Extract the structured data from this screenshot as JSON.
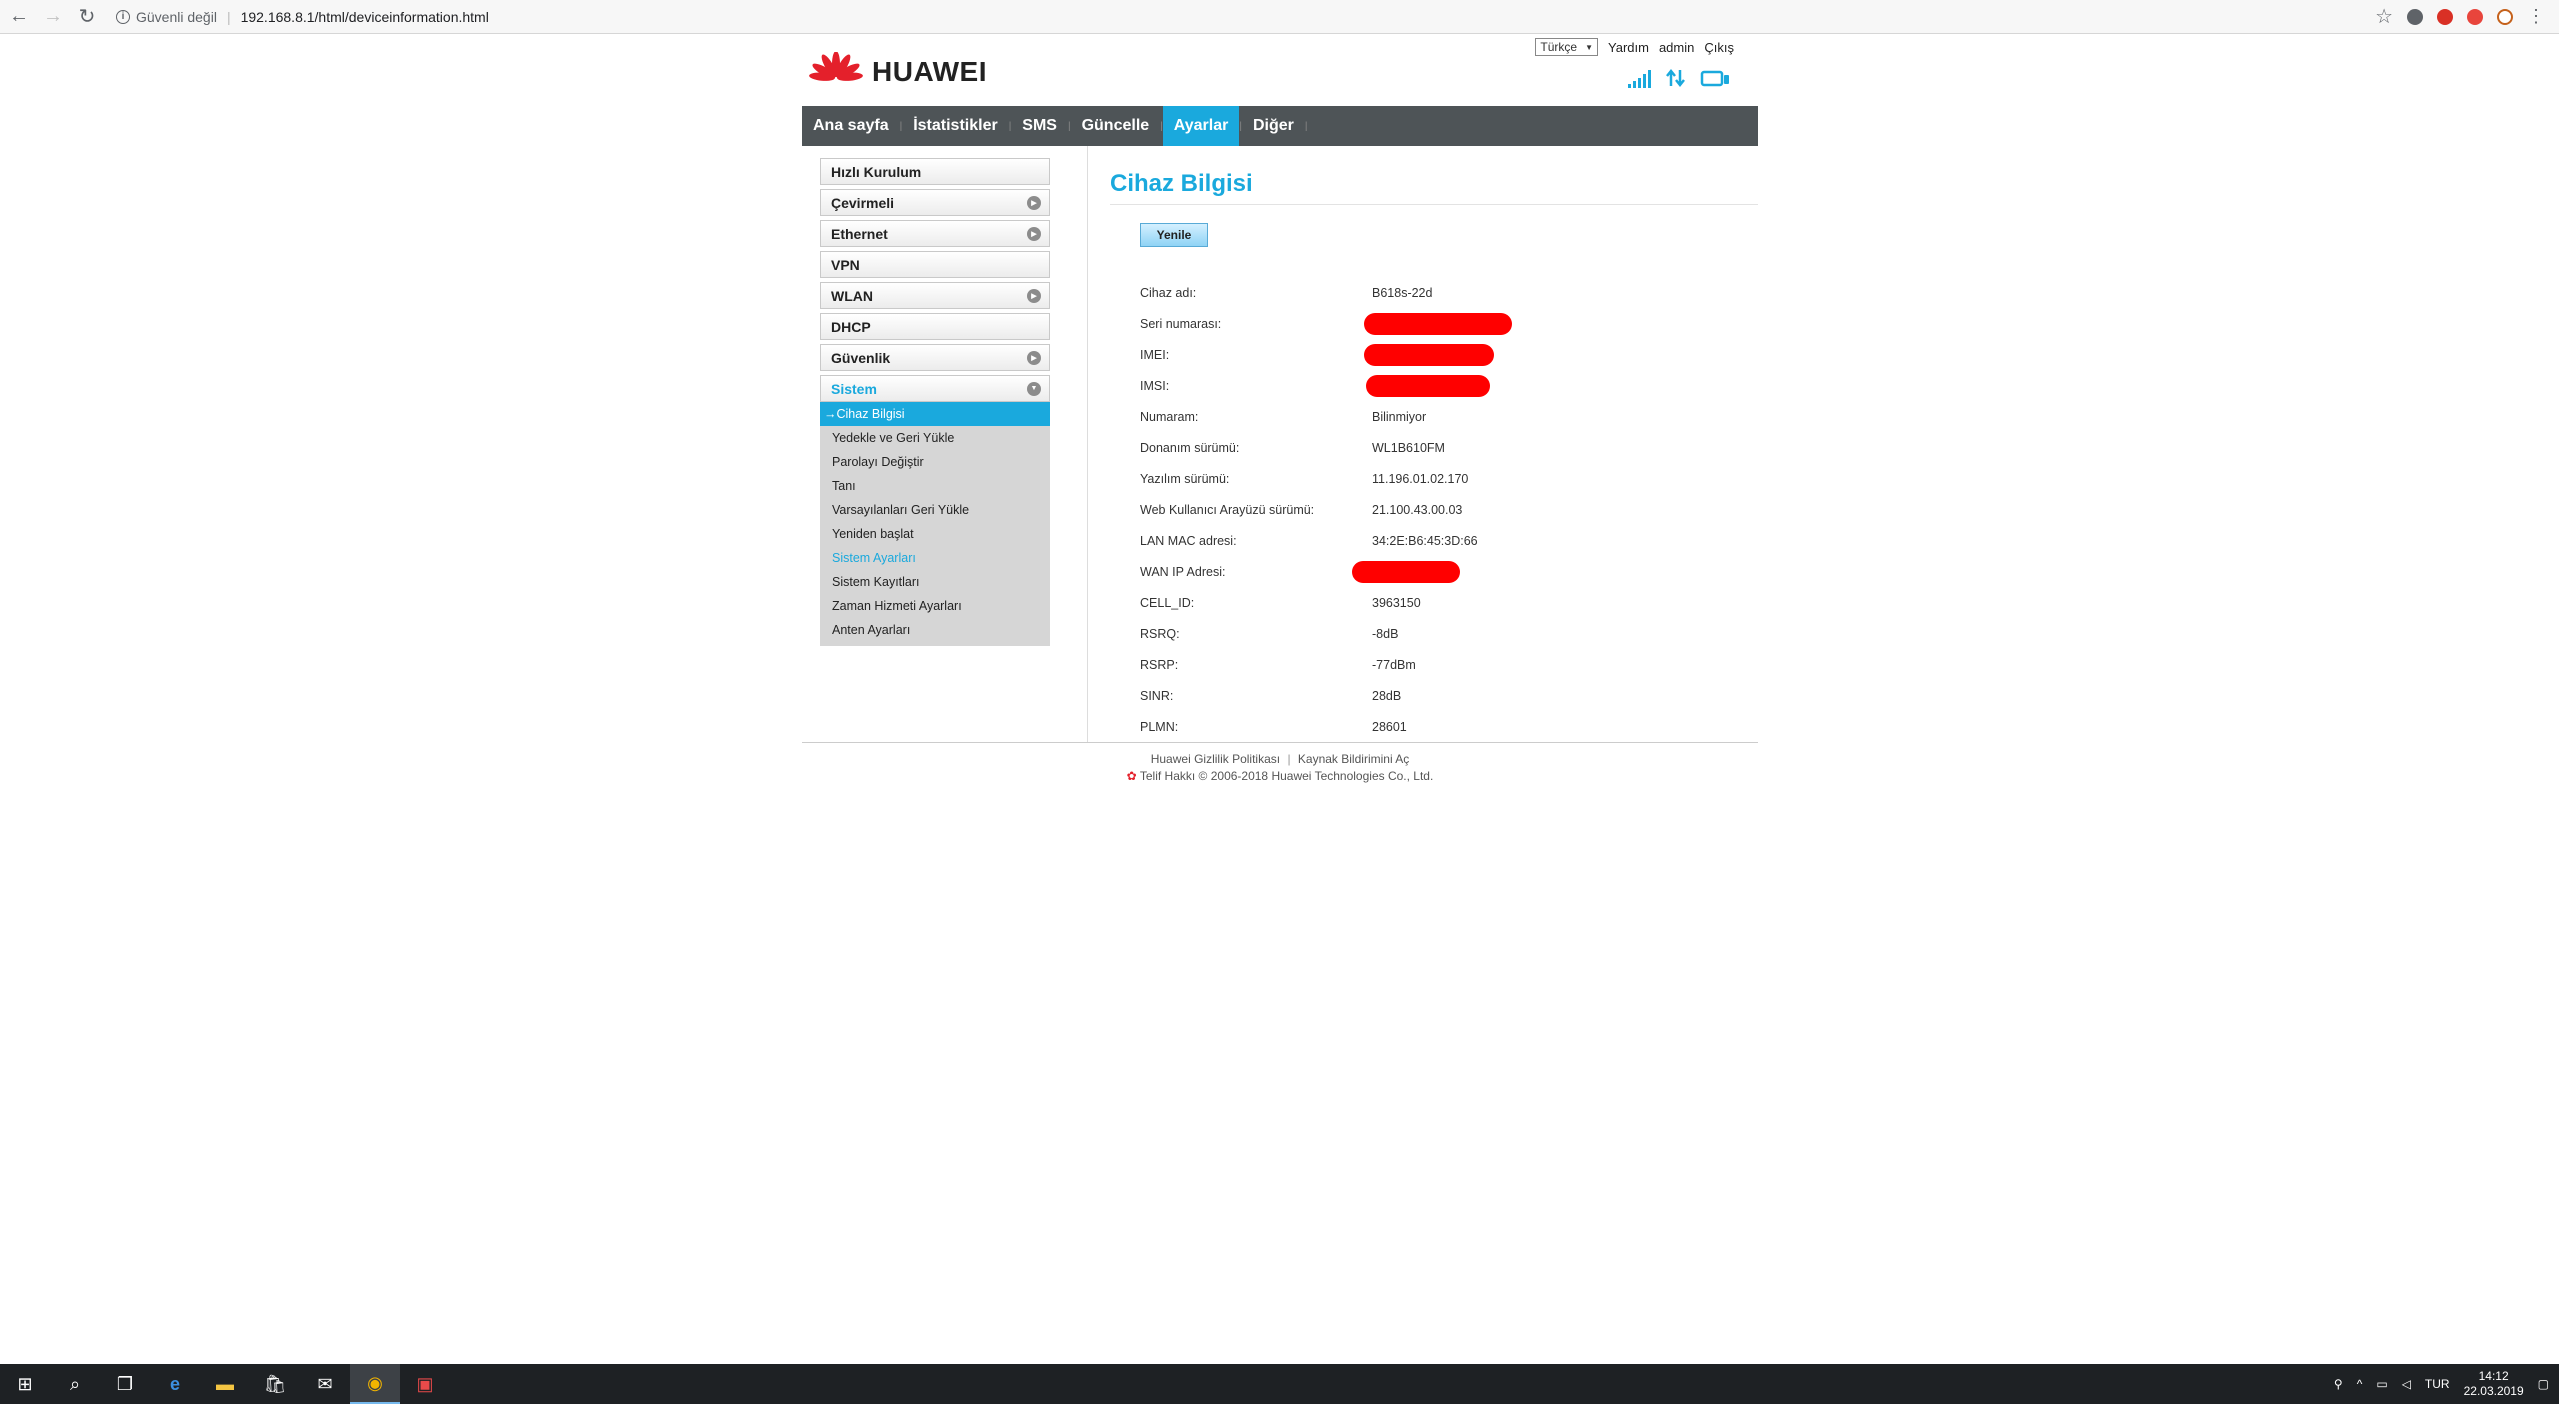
{
  "browser": {
    "security_text": "Güvenli değil",
    "url": "192.168.8.1/html/deviceinformation.html"
  },
  "header": {
    "brand": "HUAWEI",
    "language": "Türkçe",
    "help": "Yardım",
    "user": "admin",
    "logout": "Çıkış"
  },
  "menu": {
    "items": [
      "Ana sayfa",
      "İstatistikler",
      "SMS",
      "Güncelle",
      "Ayarlar",
      "Diğer"
    ],
    "active": "Ayarlar"
  },
  "sidebar": {
    "items": [
      {
        "label": "Hızlı Kurulum",
        "expandable": false
      },
      {
        "label": "Çevirmeli",
        "expandable": true
      },
      {
        "label": "Ethernet",
        "expandable": true
      },
      {
        "label": "VPN",
        "expandable": false
      },
      {
        "label": "WLAN",
        "expandable": true
      },
      {
        "label": "DHCP",
        "expandable": false
      },
      {
        "label": "Güvenlik",
        "expandable": true
      },
      {
        "label": "Sistem",
        "expandable": true,
        "open": true
      }
    ],
    "submenu": [
      "Cihaz Bilgisi",
      "Yedekle ve Geri Yükle",
      "Parolayı Değiştir",
      "Tanı",
      "Varsayılanları Geri Yükle",
      "Yeniden başlat",
      "Sistem Ayarları",
      "Sistem Kayıtları",
      "Zaman Hizmeti Ayarları",
      "Anten Ayarları"
    ],
    "active_sub": "Cihaz Bilgisi",
    "highlight_sub": "Sistem Ayarları"
  },
  "main": {
    "title": "Cihaz Bilgisi",
    "refresh_label": "Yenile",
    "rows": [
      {
        "label": "Cihaz adı:",
        "value": "B618s-22d"
      },
      {
        "label": "Seri numarası:",
        "value": "",
        "redacted": true
      },
      {
        "label": "IMEI:",
        "value": "",
        "redacted": true
      },
      {
        "label": "IMSI:",
        "value": "",
        "redacted": true
      },
      {
        "label": "Numaram:",
        "value": "Bilinmiyor"
      },
      {
        "label": "Donanım sürümü:",
        "value": "WL1B610FM"
      },
      {
        "label": "Yazılım sürümü:",
        "value": "11.196.01.02.170"
      },
      {
        "label": "Web Kullanıcı Arayüzü sürümü:",
        "value": "21.100.43.00.03"
      },
      {
        "label": "LAN MAC adresi:",
        "value": "34:2E:B6:45:3D:66"
      },
      {
        "label": "WAN IP Adresi:",
        "value": "",
        "redacted": true
      },
      {
        "label": "CELL_ID:",
        "value": "3963150"
      },
      {
        "label": "RSRQ:",
        "value": "-8dB"
      },
      {
        "label": "RSRP:",
        "value": "-77dBm"
      },
      {
        "label": "SINR:",
        "value": "28dB"
      },
      {
        "label": "PLMN:",
        "value": "28601"
      }
    ]
  },
  "footer": {
    "privacy": "Huawei Gizlilik Politikası",
    "open_source": "Kaynak Bildirimini Aç",
    "copyright": "Telif Hakkı © 2006-2018 Huawei Technologies Co., Ltd."
  },
  "taskbar": {
    "lang": "TUR",
    "time": "14:12",
    "date": "22.03.2019"
  },
  "colors": {
    "accent": "#1aa9dd",
    "menubar": "#4e5457",
    "redaction": "#ff0000",
    "brand_red": "#e4202b"
  }
}
